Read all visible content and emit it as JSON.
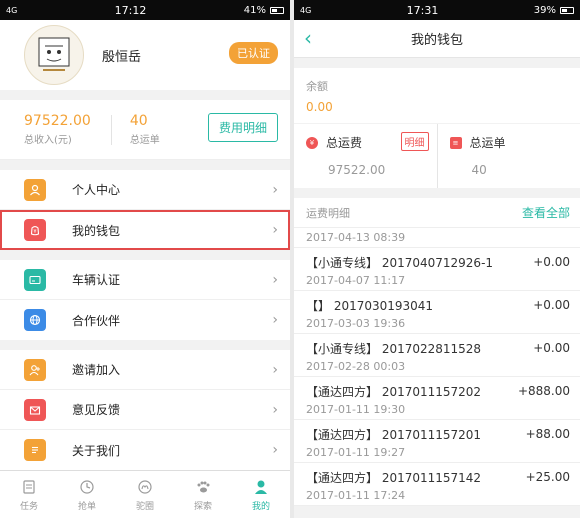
{
  "left": {
    "status": {
      "carrier": "4G",
      "time": "17:12",
      "battery": "41%"
    },
    "profile": {
      "name": "殷恒岳",
      "verified": "已认证"
    },
    "stats": [
      {
        "value": "97522.00",
        "label": "总收入(元)"
      },
      {
        "value": "40",
        "label": "总运单"
      }
    ],
    "detail_button": "费用明细",
    "menu_groups": [
      [
        {
          "label": "个人中心",
          "icon": "person-icon",
          "color": "#f3a237"
        },
        {
          "label": "我的钱包",
          "icon": "wallet-icon",
          "color": "#ef5656"
        }
      ],
      [
        {
          "label": "车辆认证",
          "icon": "card-icon",
          "color": "#2ab9a5"
        },
        {
          "label": "合作伙伴",
          "icon": "globe-icon",
          "color": "#3c8be6"
        }
      ],
      [
        {
          "label": "邀请加入",
          "icon": "add-person-icon",
          "color": "#f3a237"
        },
        {
          "label": "意见反馈",
          "icon": "mail-icon",
          "color": "#ef5656"
        },
        {
          "label": "关于我们",
          "icon": "doc-icon",
          "color": "#f3a237"
        }
      ]
    ],
    "tabs": [
      {
        "label": "任务"
      },
      {
        "label": "抢单"
      },
      {
        "label": "驼圈"
      },
      {
        "label": "探索"
      },
      {
        "label": "我的"
      }
    ]
  },
  "right": {
    "status": {
      "carrier": "4G",
      "time": "17:31",
      "battery": "39%"
    },
    "title": "我的钱包",
    "balance": {
      "label": "余额",
      "value": "0.00"
    },
    "summary": {
      "fee_label": "总运费",
      "fee_detail": "明细",
      "fee_value": "97522.00",
      "orders_label": "总运单",
      "orders_value": "40"
    },
    "records_header": {
      "label": "运费明细",
      "view_all": "查看全部"
    },
    "records_partial_date": "2017-04-13 08:39",
    "records": [
      {
        "title": "【小通专线】 2017040712926-1",
        "date": "2017-04-07 11:17",
        "amount": "+0.00"
      },
      {
        "title": "【】 2017030193041",
        "date": "2017-03-03 19:36",
        "amount": "+0.00"
      },
      {
        "title": "【小通专线】 2017022811528",
        "date": "2017-02-28 00:03",
        "amount": "+0.00"
      },
      {
        "title": "【通达四方】 2017011157202",
        "date": "2017-01-11 19:30",
        "amount": "+888.00"
      },
      {
        "title": "【通达四方】 2017011157201",
        "date": "2017-01-11 19:27",
        "amount": "+88.00"
      },
      {
        "title": "【通达四方】 2017011157142",
        "date": "2017-01-11 17:24",
        "amount": "+25.00"
      }
    ]
  }
}
